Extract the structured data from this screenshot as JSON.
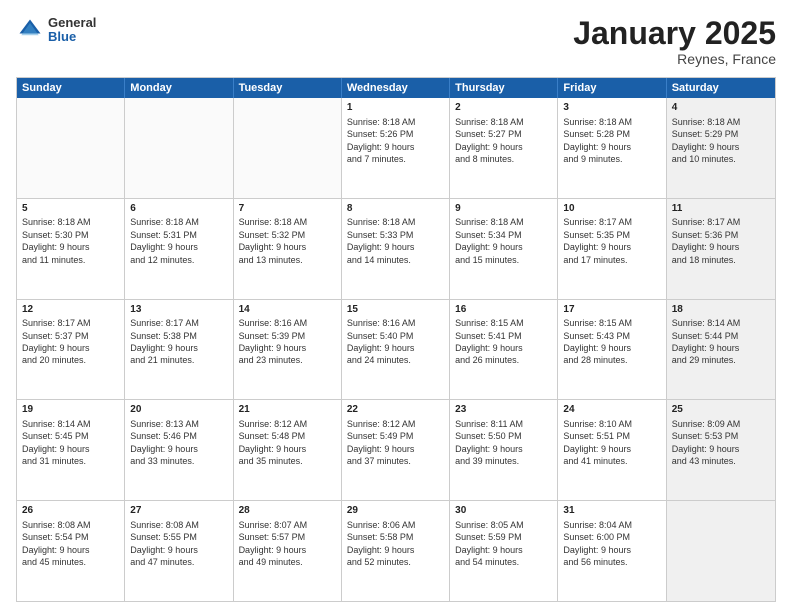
{
  "header": {
    "logo_general": "General",
    "logo_blue": "Blue",
    "month_title": "January 2025",
    "location": "Reynes, France"
  },
  "weekdays": [
    "Sunday",
    "Monday",
    "Tuesday",
    "Wednesday",
    "Thursday",
    "Friday",
    "Saturday"
  ],
  "rows": [
    [
      {
        "day": "",
        "text": "",
        "empty": true
      },
      {
        "day": "",
        "text": "",
        "empty": true
      },
      {
        "day": "",
        "text": "",
        "empty": true
      },
      {
        "day": "1",
        "text": "Sunrise: 8:18 AM\nSunset: 5:26 PM\nDaylight: 9 hours\nand 7 minutes."
      },
      {
        "day": "2",
        "text": "Sunrise: 8:18 AM\nSunset: 5:27 PM\nDaylight: 9 hours\nand 8 minutes."
      },
      {
        "day": "3",
        "text": "Sunrise: 8:18 AM\nSunset: 5:28 PM\nDaylight: 9 hours\nand 9 minutes."
      },
      {
        "day": "4",
        "text": "Sunrise: 8:18 AM\nSunset: 5:29 PM\nDaylight: 9 hours\nand 10 minutes.",
        "shaded": true
      }
    ],
    [
      {
        "day": "5",
        "text": "Sunrise: 8:18 AM\nSunset: 5:30 PM\nDaylight: 9 hours\nand 11 minutes."
      },
      {
        "day": "6",
        "text": "Sunrise: 8:18 AM\nSunset: 5:31 PM\nDaylight: 9 hours\nand 12 minutes."
      },
      {
        "day": "7",
        "text": "Sunrise: 8:18 AM\nSunset: 5:32 PM\nDaylight: 9 hours\nand 13 minutes."
      },
      {
        "day": "8",
        "text": "Sunrise: 8:18 AM\nSunset: 5:33 PM\nDaylight: 9 hours\nand 14 minutes."
      },
      {
        "day": "9",
        "text": "Sunrise: 8:18 AM\nSunset: 5:34 PM\nDaylight: 9 hours\nand 15 minutes."
      },
      {
        "day": "10",
        "text": "Sunrise: 8:17 AM\nSunset: 5:35 PM\nDaylight: 9 hours\nand 17 minutes."
      },
      {
        "day": "11",
        "text": "Sunrise: 8:17 AM\nSunset: 5:36 PM\nDaylight: 9 hours\nand 18 minutes.",
        "shaded": true
      }
    ],
    [
      {
        "day": "12",
        "text": "Sunrise: 8:17 AM\nSunset: 5:37 PM\nDaylight: 9 hours\nand 20 minutes."
      },
      {
        "day": "13",
        "text": "Sunrise: 8:17 AM\nSunset: 5:38 PM\nDaylight: 9 hours\nand 21 minutes."
      },
      {
        "day": "14",
        "text": "Sunrise: 8:16 AM\nSunset: 5:39 PM\nDaylight: 9 hours\nand 23 minutes."
      },
      {
        "day": "15",
        "text": "Sunrise: 8:16 AM\nSunset: 5:40 PM\nDaylight: 9 hours\nand 24 minutes."
      },
      {
        "day": "16",
        "text": "Sunrise: 8:15 AM\nSunset: 5:41 PM\nDaylight: 9 hours\nand 26 minutes."
      },
      {
        "day": "17",
        "text": "Sunrise: 8:15 AM\nSunset: 5:43 PM\nDaylight: 9 hours\nand 28 minutes."
      },
      {
        "day": "18",
        "text": "Sunrise: 8:14 AM\nSunset: 5:44 PM\nDaylight: 9 hours\nand 29 minutes.",
        "shaded": true
      }
    ],
    [
      {
        "day": "19",
        "text": "Sunrise: 8:14 AM\nSunset: 5:45 PM\nDaylight: 9 hours\nand 31 minutes."
      },
      {
        "day": "20",
        "text": "Sunrise: 8:13 AM\nSunset: 5:46 PM\nDaylight: 9 hours\nand 33 minutes."
      },
      {
        "day": "21",
        "text": "Sunrise: 8:12 AM\nSunset: 5:48 PM\nDaylight: 9 hours\nand 35 minutes."
      },
      {
        "day": "22",
        "text": "Sunrise: 8:12 AM\nSunset: 5:49 PM\nDaylight: 9 hours\nand 37 minutes."
      },
      {
        "day": "23",
        "text": "Sunrise: 8:11 AM\nSunset: 5:50 PM\nDaylight: 9 hours\nand 39 minutes."
      },
      {
        "day": "24",
        "text": "Sunrise: 8:10 AM\nSunset: 5:51 PM\nDaylight: 9 hours\nand 41 minutes."
      },
      {
        "day": "25",
        "text": "Sunrise: 8:09 AM\nSunset: 5:53 PM\nDaylight: 9 hours\nand 43 minutes.",
        "shaded": true
      }
    ],
    [
      {
        "day": "26",
        "text": "Sunrise: 8:08 AM\nSunset: 5:54 PM\nDaylight: 9 hours\nand 45 minutes."
      },
      {
        "day": "27",
        "text": "Sunrise: 8:08 AM\nSunset: 5:55 PM\nDaylight: 9 hours\nand 47 minutes."
      },
      {
        "day": "28",
        "text": "Sunrise: 8:07 AM\nSunset: 5:57 PM\nDaylight: 9 hours\nand 49 minutes."
      },
      {
        "day": "29",
        "text": "Sunrise: 8:06 AM\nSunset: 5:58 PM\nDaylight: 9 hours\nand 52 minutes."
      },
      {
        "day": "30",
        "text": "Sunrise: 8:05 AM\nSunset: 5:59 PM\nDaylight: 9 hours\nand 54 minutes."
      },
      {
        "day": "31",
        "text": "Sunrise: 8:04 AM\nSunset: 6:00 PM\nDaylight: 9 hours\nand 56 minutes."
      },
      {
        "day": "",
        "text": "",
        "empty": true,
        "shaded": true
      }
    ]
  ]
}
